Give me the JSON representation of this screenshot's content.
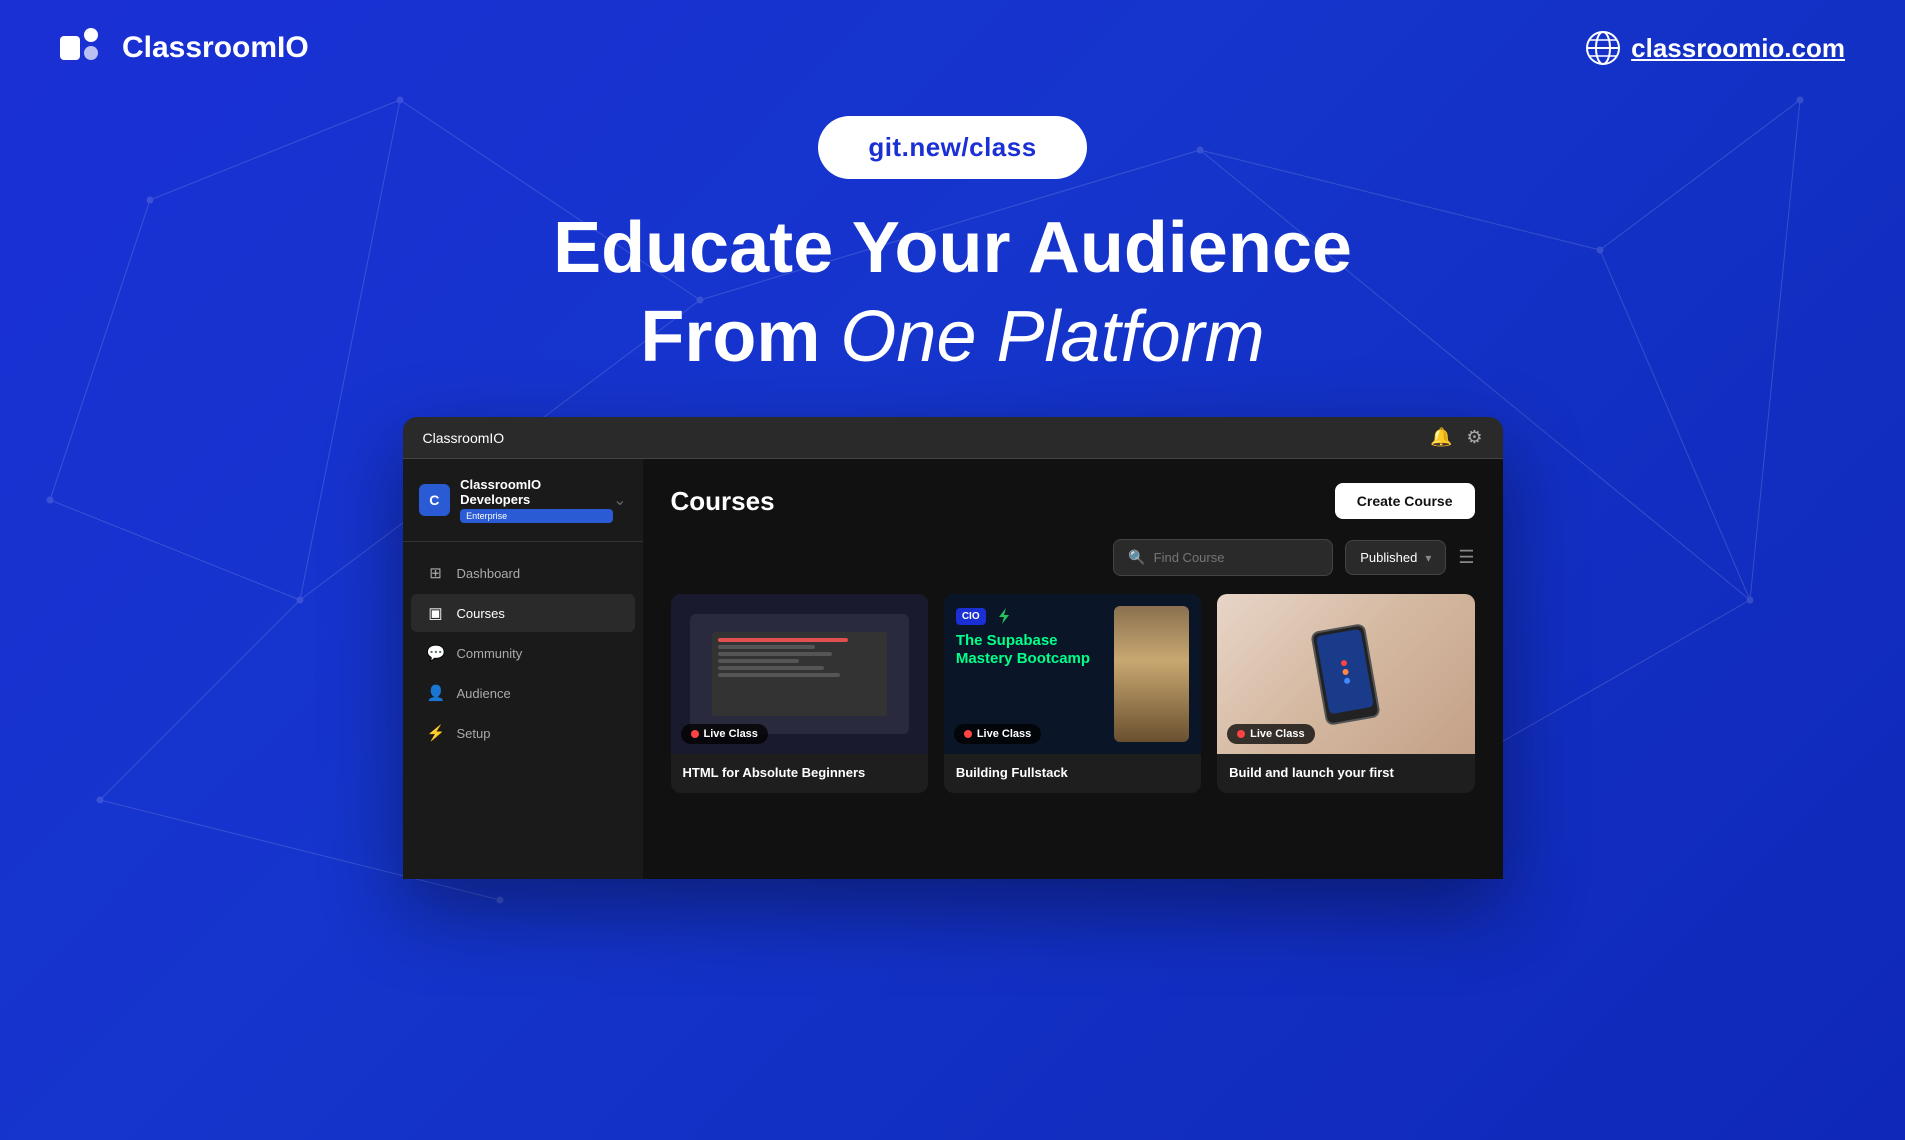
{
  "top_nav": {
    "logo_text": "ClassroomIO",
    "site_link_text": "classroomio.com"
  },
  "hero": {
    "url_pill": "git.new/class",
    "headline_line1": "Educate Your Audience",
    "headline_line2_normal": "From ",
    "headline_line2_italic": "One  Platform"
  },
  "window": {
    "title": "ClassroomIO",
    "bell_icon": "🔔",
    "gear_icon": "⚙"
  },
  "sidebar": {
    "org_name": "ClassroomIO Developers",
    "org_badge": "Enterprise",
    "nav_items": [
      {
        "label": "Dashboard",
        "icon": "⊞",
        "active": false
      },
      {
        "label": "Courses",
        "icon": "▣",
        "active": true
      },
      {
        "label": "Community",
        "icon": "💬",
        "active": false
      },
      {
        "label": "Audience",
        "icon": "👤",
        "active": false
      },
      {
        "label": "Setup",
        "icon": "⚡",
        "active": false
      }
    ]
  },
  "courses": {
    "title": "Courses",
    "create_btn": "Create Course",
    "search_placeholder": "Find Course",
    "filter_label": "Published",
    "cards": [
      {
        "title": "HTML for Absolute Beginners",
        "badge": "Live Class",
        "thumb_type": "coding"
      },
      {
        "title": "Building Fullstack",
        "supabase_title": "The Supabase Mastery Bootcamp",
        "badge": "Live Class",
        "thumb_type": "supabase"
      },
      {
        "title": "Build and launch your first",
        "badge": "Live Class",
        "thumb_type": "mobile"
      }
    ]
  },
  "colors": {
    "brand_blue": "#1a35cc",
    "accent_green": "#00ff88",
    "live_red": "#ff4444"
  }
}
